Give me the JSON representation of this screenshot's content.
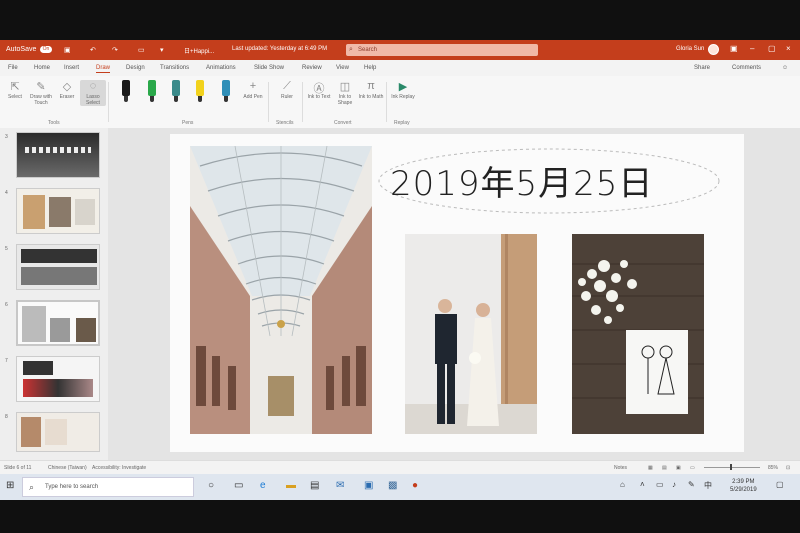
{
  "titlebar": {
    "autosave_label": "AutoSave",
    "autosave_state": "On",
    "file_name": "日+Happi...",
    "last_updated": "Last updated: Yesterday at 6:49 PM",
    "search_placeholder": "Search",
    "user_name": "Gloria Sun"
  },
  "tabs": [
    "File",
    "Home",
    "Insert",
    "Draw",
    "Design",
    "Transitions",
    "Animations",
    "Slide Show",
    "Review",
    "View",
    "Help"
  ],
  "active_tab": "Draw",
  "share_label": "Share",
  "comments_label": "Comments",
  "ribbon": {
    "select": "Select",
    "draw_with_touch": "Draw with Touch",
    "eraser": "Eraser",
    "lasso_select": "Lasso Select",
    "add_pen": "Add Pen",
    "ruler": "Ruler",
    "ink_to_text": "Ink to Text",
    "ink_to_shape": "Ink to Shape",
    "ink_to_math": "Ink to Math",
    "ink_replay": "Ink Replay",
    "groups": [
      "Tools",
      "Pens",
      "Stencils",
      "Convert",
      "Replay"
    ]
  },
  "pen_colors": [
    "#1a1a1a",
    "#2aa84a",
    "#3a8a8a",
    "#f2d21c",
    "#2f8fb8"
  ],
  "thumbnails": [
    "3",
    "4",
    "5",
    "6",
    "7",
    "8"
  ],
  "slide": {
    "ink_text": "2019年5月25日"
  },
  "status": {
    "slide_info": "Slide 6 of 11",
    "language": "Chinese (Taiwan)",
    "accessibility": "Accessibility: Investigate",
    "notes": "Notes",
    "zoom": "85%"
  },
  "taskbar": {
    "search_placeholder": "Type here to search",
    "time": "2:39 PM",
    "date": "5/29/2019"
  }
}
